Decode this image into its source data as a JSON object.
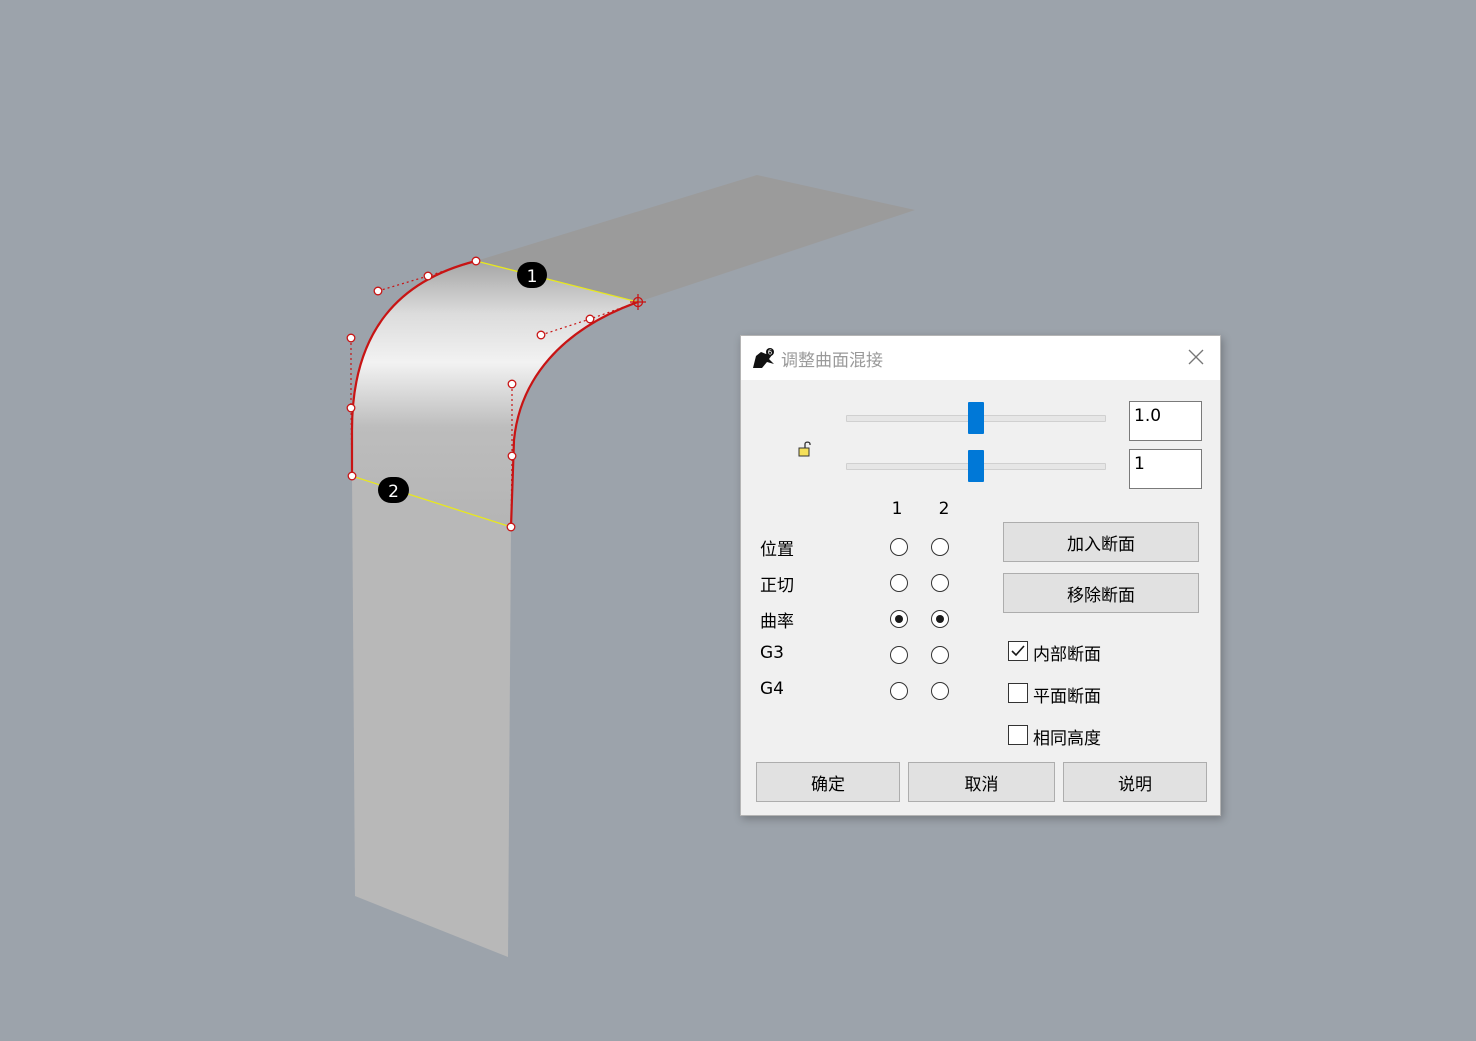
{
  "viewport": {
    "edge_labels": [
      "1",
      "2"
    ]
  },
  "dialog": {
    "title": "调整曲面混接",
    "slider1_value": "1.0",
    "slider2_value": "1",
    "slider1_position": 0.5,
    "slider2_position": 0.5,
    "column_headers": [
      "1",
      "2"
    ],
    "rows": [
      {
        "label": "位置",
        "col1": false,
        "col2": false
      },
      {
        "label": "正切",
        "col1": false,
        "col2": false
      },
      {
        "label": "曲率",
        "col1": true,
        "col2": true
      },
      {
        "label": "G3",
        "col1": false,
        "col2": false
      },
      {
        "label": "G4",
        "col1": false,
        "col2": false
      }
    ],
    "add_section_label": "加入断面",
    "remove_section_label": "移除断面",
    "checkboxes": [
      {
        "label": "内部断面",
        "checked": true
      },
      {
        "label": "平面断面",
        "checked": false
      },
      {
        "label": "相同高度",
        "checked": false
      }
    ],
    "ok_label": "确定",
    "cancel_label": "取消",
    "help_label": "说明"
  },
  "colors": {
    "background": "#9ca3ab",
    "curve": "#c81414",
    "edge": "#e8e81e",
    "accent": "#0078d7"
  }
}
